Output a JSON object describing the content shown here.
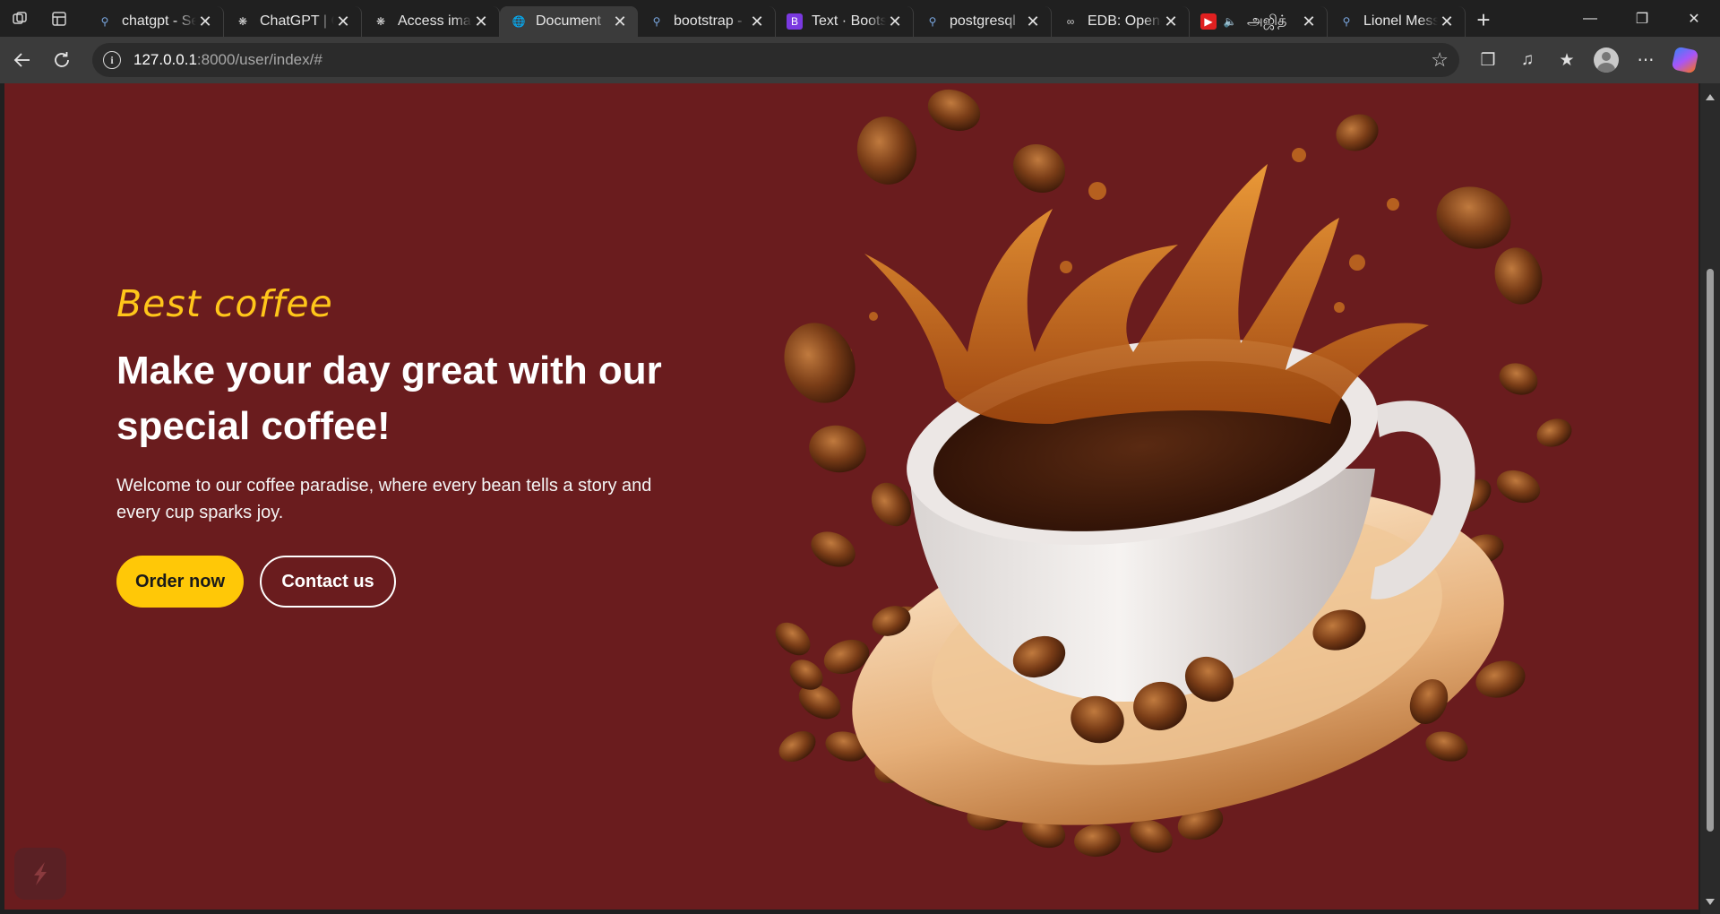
{
  "browser": {
    "tabs": [
      {
        "title": "chatgpt - Se",
        "icon": "search-icon",
        "active": false
      },
      {
        "title": "ChatGPT | C",
        "icon": "chatgpt-icon",
        "active": false
      },
      {
        "title": "Access imag",
        "icon": "chatgpt-icon",
        "active": false
      },
      {
        "title": "Document",
        "icon": "globe-icon",
        "active": true
      },
      {
        "title": "bootstrap -",
        "icon": "search-icon",
        "active": false
      },
      {
        "title": "Text · Boots",
        "icon": "bootstrap-icon",
        "active": false
      },
      {
        "title": "postgresql",
        "icon": "search-icon",
        "active": false
      },
      {
        "title": "EDB: Open-",
        "icon": "edb-icon",
        "active": false
      },
      {
        "title": "அஜித்",
        "icon": "youtube-icon",
        "active": false,
        "audio": true
      },
      {
        "title": "Lionel Mess",
        "icon": "search-icon",
        "active": false
      }
    ],
    "url_host": "127.0.0.1",
    "url_path": ":8000/user/index/#"
  },
  "hero": {
    "eyebrow": "Best coffee",
    "headline": "Make your day great with our special coffee!",
    "lead": "Welcome to our coffee paradise, where every bean tells a story and every cup sparks joy.",
    "order_label": "Order now",
    "contact_label": "Contact us"
  },
  "colors": {
    "page_bg": "#6a1c1e",
    "accent": "#ffc807",
    "eyebrow": "#ffc61a"
  }
}
